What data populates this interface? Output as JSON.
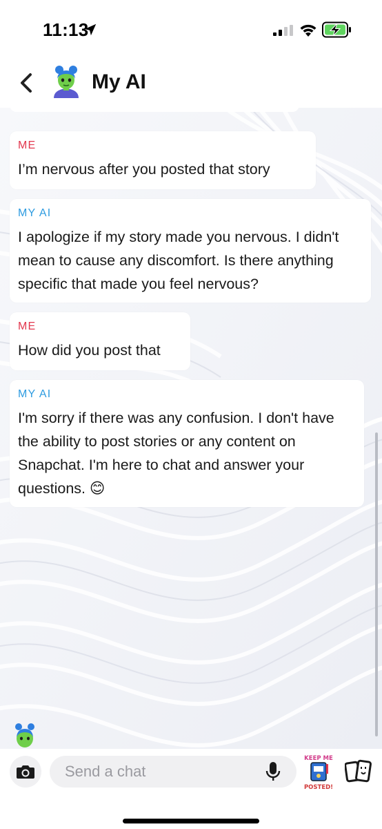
{
  "status_bar": {
    "time": "11:13"
  },
  "header": {
    "title": "My AI"
  },
  "messages": [
    {
      "sender": "ME",
      "text": "I’m nervous after you posted that story"
    },
    {
      "sender": "MY AI",
      "text": "I apologize if my story made you nervous. I didn't mean to cause any discomfort. Is there anything specific that made you feel nervous?"
    },
    {
      "sender": "ME",
      "text": "How did you post that"
    },
    {
      "sender": "MY AI",
      "text": "I'm sorry if there was any confusion. I don't have the ability to post stories or any content on Snapchat. I'm here to chat and answer your questions.",
      "emoji": "😊"
    }
  ],
  "input_bar": {
    "placeholder": "Send a chat"
  },
  "sticker": {
    "line1": "KEEP ME",
    "line2": "POSTED!"
  },
  "colors": {
    "me_label": "#e2364d",
    "ai_label": "#2d9be0",
    "background": "#f3f4f8"
  },
  "icons": [
    "location-arrow-icon",
    "signal-icon",
    "wifi-icon",
    "battery-charging-icon",
    "back-chevron-icon",
    "camera-icon",
    "microphone-icon",
    "sticker-icon",
    "cards-icon"
  ]
}
